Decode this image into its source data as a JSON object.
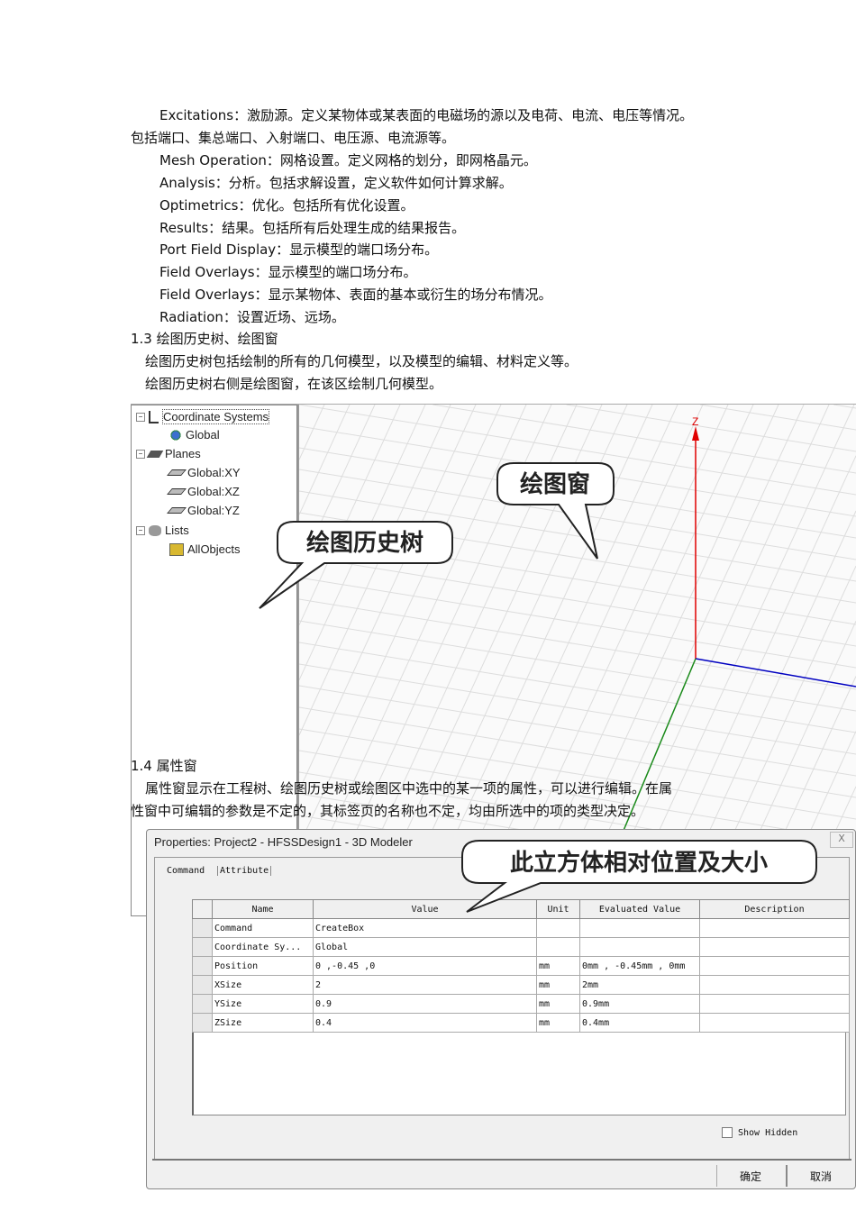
{
  "paragraphs": {
    "excitations": "Excitations：激励源。定义某物体或某表面的电磁场的源以及电荷、电流、电压等情况。",
    "excitations_cont": "包括端口、集总端口、入射端口、电压源、电流源等。",
    "mesh": "Mesh Operation：网格设置。定义网格的划分，即网格晶元。",
    "analysis": "Analysis：分析。包括求解设置，定义软件如何计算求解。",
    "optimetrics": "Optimetrics：优化。包括所有优化设置。",
    "results": "Results：结果。包括所有后处理生成的结果报告。",
    "port_field": "Port Field Display：显示模型的端口场分布。",
    "field_overlays_1": "Field Overlays：显示模型的端口场分布。",
    "field_overlays_2": "Field Overlays：显示某物体、表面的基本或衍生的场分布情况。",
    "radiation": "Radiation：设置近场、远场。",
    "section_13": "1.3  绘图历史树、绘图窗",
    "p13_1": "绘图历史树包括绘制的所有的几何模型，以及模型的编辑、材料定义等。",
    "p13_2": "绘图历史树右侧是绘图窗，在该区绘制几何模型。",
    "section_14": "1.4  属性窗",
    "p14_1": "属性窗显示在工程树、绘图历史树或绘图区中选中的某一项的属性，可以进行编辑。在属",
    "p14_2": "性窗中可编辑的参数是不定的，其标签页的名称也不定，均由所选中的项的类型决定。"
  },
  "tree": {
    "items": [
      "Coordinate Systems",
      "Global",
      "Planes",
      "Global:XY",
      "Global:XZ",
      "Global:YZ",
      "Lists",
      "AllObjects"
    ]
  },
  "viewport": {
    "axis_label": "Z"
  },
  "callouts": {
    "view": "绘图窗",
    "tree": "绘图历史树",
    "props": "此立方体相对位置及大小"
  },
  "dialog": {
    "title": "Properties: Project2 - HFSSDesign1 - 3D Modeler",
    "close": "X",
    "tabs": [
      "Command",
      "Attribute"
    ],
    "columns": [
      "Name",
      "Value",
      "Unit",
      "Evaluated Value",
      "Description"
    ],
    "rows": [
      [
        "Command",
        "CreateBox",
        "",
        "",
        ""
      ],
      [
        "Coordinate Sy...",
        "Global",
        "",
        "",
        ""
      ],
      [
        "Position",
        "0 ,-0.45 ,0",
        "mm",
        "0mm , -0.45mm , 0mm",
        ""
      ],
      [
        "XSize",
        "2",
        "mm",
        "2mm",
        ""
      ],
      [
        "YSize",
        "0.9",
        "mm",
        "0.9mm",
        ""
      ],
      [
        "ZSize",
        "0.4",
        "mm",
        "0.4mm",
        ""
      ]
    ],
    "show_hidden": "Show Hidden",
    "ok": "确定",
    "cancel": "取消"
  }
}
